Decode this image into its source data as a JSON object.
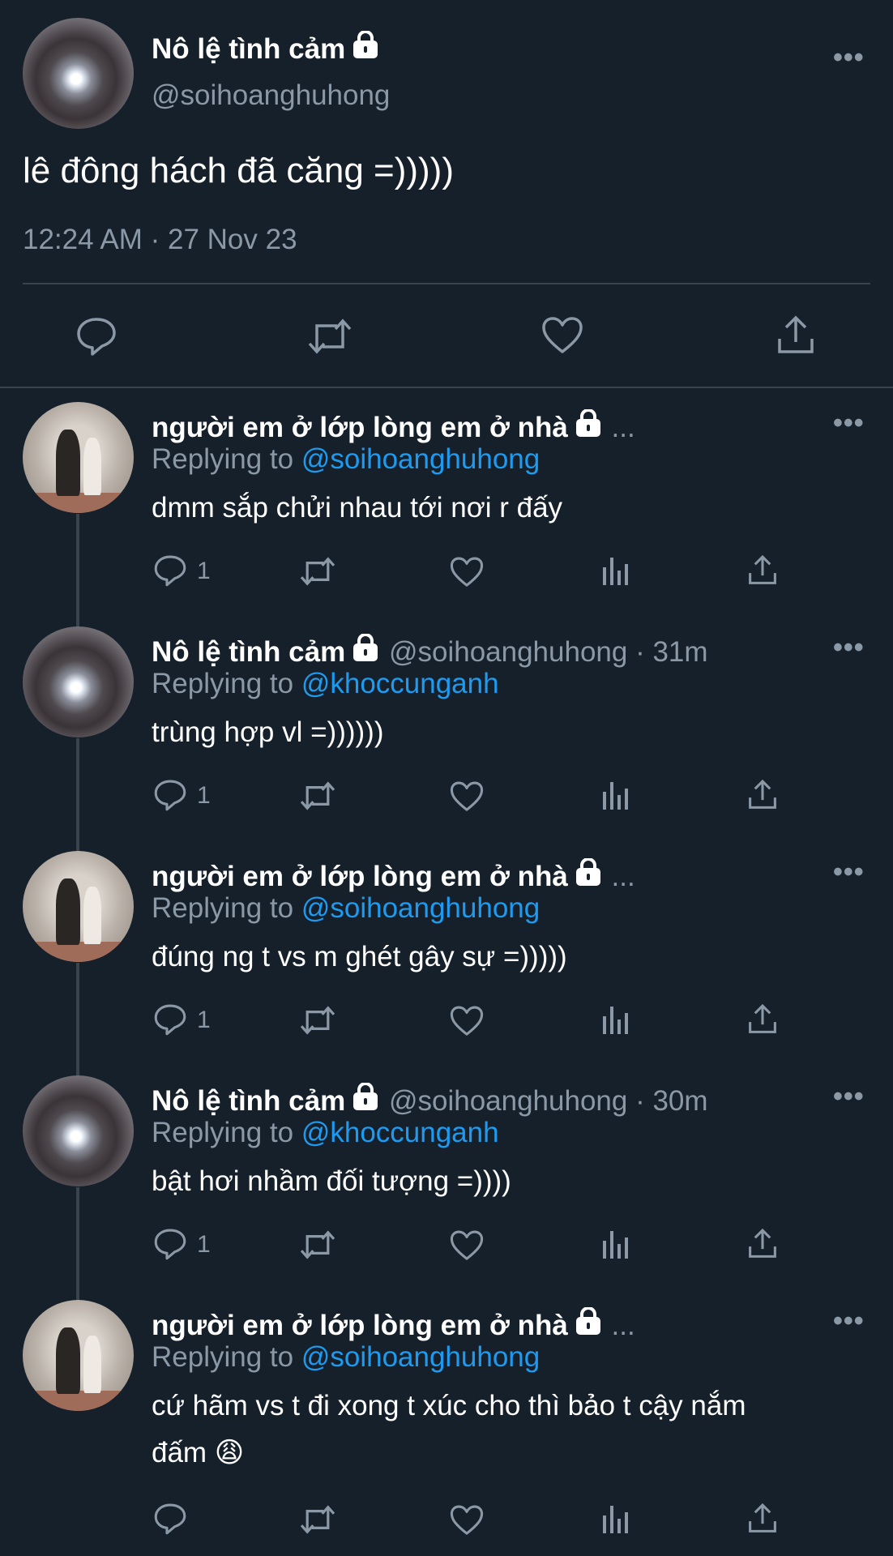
{
  "main_tweet": {
    "name": "Nô lệ tình cảm",
    "handle": "@soihoanghuhong",
    "text": "lê đông hách đã căng =)))))",
    "timestamp": "12:24 AM · 27 Nov 23",
    "more_label": "•••"
  },
  "replies": [
    {
      "name": "người em ở lớp lòng em ở nhà",
      "after_name": "...",
      "replying_prefix": "Replying to ",
      "replying_to": "@soihoanghuhong",
      "text": "dmm sắp chửi nhau tới nơi r đấy",
      "reply_count": "1"
    },
    {
      "name": "Nô lệ tình cảm",
      "after_name": "@soihoanghuhong · 31m",
      "replying_prefix": "Replying to ",
      "replying_to": "@khoccunganh",
      "text": "trùng hợp vl =))))))",
      "reply_count": "1"
    },
    {
      "name": "người em ở lớp lòng em ở nhà",
      "after_name": "...",
      "replying_prefix": "Replying to ",
      "replying_to": "@soihoanghuhong",
      "text": "đúng ng t vs m ghét gây sự =)))))",
      "reply_count": "1"
    },
    {
      "name": "Nô lệ tình cảm",
      "after_name": "@soihoanghuhong · 30m",
      "replying_prefix": "Replying to ",
      "replying_to": "@khoccunganh",
      "text": "bật hơi nhầm đối tượng =))))",
      "reply_count": "1"
    },
    {
      "name": "người em ở lớp lòng em ở nhà",
      "after_name": "...",
      "replying_prefix": "Replying to ",
      "replying_to": "@soihoanghuhong",
      "text_line1": "cứ hãm vs t đi xong t xúc cho thì bảo t cậy nắm",
      "text_line2": "đấm 😩",
      "reply_count": ""
    }
  ],
  "icons": [
    "reply-icon",
    "retweet-icon",
    "like-icon",
    "share-icon",
    "analytics-icon",
    "lock-icon",
    "more-icon"
  ],
  "colors": {
    "background": "#15202b",
    "secondary_text": "#8b98a5",
    "link": "#1d9bf0",
    "divider": "#38444d"
  }
}
